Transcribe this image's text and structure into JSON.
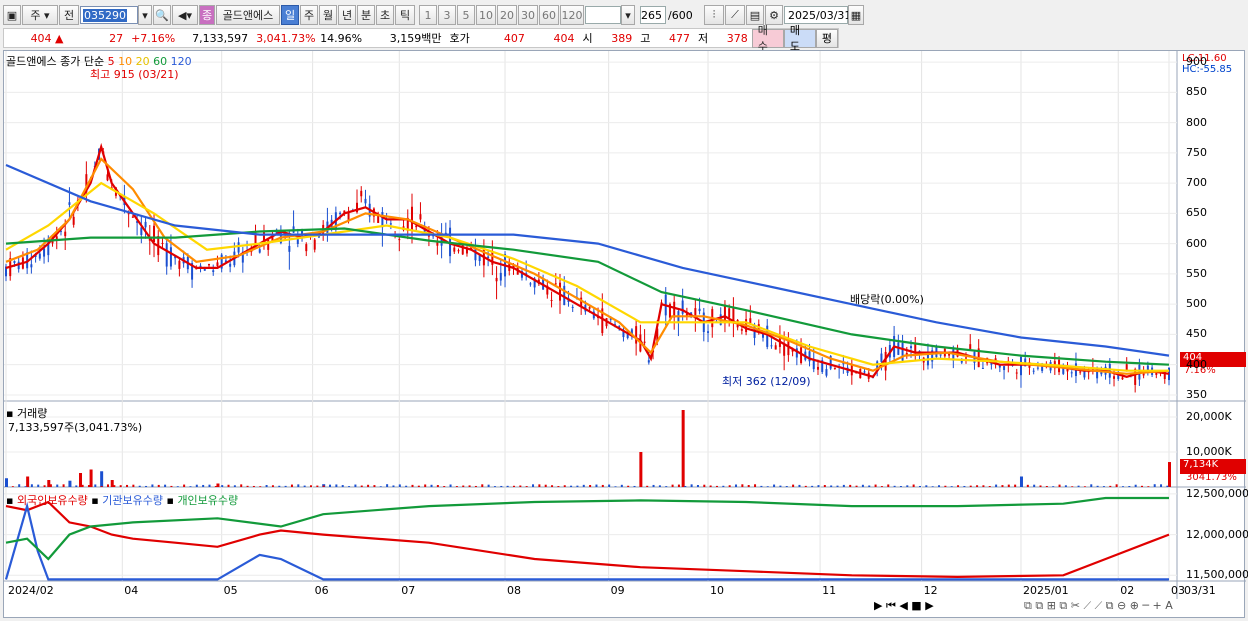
{
  "toolbar": {
    "market": "주",
    "prev": "전",
    "code": "035290",
    "stock_name": "골드앤에스",
    "period_buttons": [
      "일",
      "주",
      "월",
      "년",
      "분",
      "초",
      "틱"
    ],
    "selected_period": "일",
    "intervals": [
      "1",
      "3",
      "5",
      "10",
      "20",
      "30",
      "60",
      "120"
    ],
    "count": "265",
    "count_max": "/600",
    "date": "2025/03/31"
  },
  "quote": {
    "price": "404 ▲",
    "change": "27",
    "change_pct": "+7.16%",
    "volume": "7,133,597",
    "volume_ratio": "3,041.73%",
    "turnover": "14.96%",
    "amount": "3,159백만",
    "hoga_label": "호가",
    "ask": "407",
    "bid": "404",
    "open_label": "시",
    "open": "389",
    "high_label": "고",
    "high": "477",
    "low_label": "저",
    "low": "378",
    "buy": "매수",
    "sell": "매도",
    "avg": "평"
  },
  "price_panel": {
    "name": "골드앤에스",
    "legend_prefix": "종가 단순",
    "ma": [
      "5",
      "10",
      "20",
      "60",
      "120"
    ],
    "ma_colors": [
      "#e00000",
      "#ff8c00",
      "#ffd700",
      "#129a3a",
      "#2a5bd7"
    ],
    "high_note": "최고 915 (03/21)",
    "low_note": "최저 362 (12/09)",
    "dividend_note": "배당락(0.00%)",
    "lc": "LC:11.60",
    "hc": "HC:-55.85",
    "last_price": "404",
    "last_pct": "7.16%"
  },
  "volume_panel": {
    "title": "거래량",
    "info": "7,133,597주(3,041.73%)",
    "last": "7,134K",
    "last_pct": "3041.73%"
  },
  "holding_panel": {
    "series": [
      "외국인보유수량",
      "기관보유수량",
      "개인보유수량"
    ],
    "colors": [
      "#e00000",
      "#2a5bd7",
      "#129a3a"
    ]
  },
  "x_labels": [
    "2024/02",
    "04",
    "05",
    "06",
    "07",
    "08",
    "09",
    "10",
    "11",
    "12",
    "2025/01",
    "02",
    "03",
    "03/31"
  ],
  "chart_data": [
    {
      "type": "line",
      "title": "골드앤에스",
      "y_ticks": [
        350,
        400,
        450,
        500,
        550,
        600,
        650,
        700,
        750,
        800,
        850,
        900
      ],
      "ylim": [
        340,
        915
      ],
      "series": [
        {
          "name": "5",
          "points": [
            [
              0,
              560
            ],
            [
              10,
              570
            ],
            [
              20,
              600
            ],
            [
              30,
              640
            ],
            [
              40,
              700
            ],
            [
              45,
              760
            ],
            [
              50,
              700
            ],
            [
              60,
              650
            ],
            [
              70,
              600
            ],
            [
              80,
              580
            ],
            [
              90,
              560
            ],
            [
              100,
              560
            ],
            [
              110,
              580
            ],
            [
              120,
              600
            ],
            [
              130,
              620
            ],
            [
              140,
              610
            ],
            [
              150,
              620
            ],
            [
              160,
              650
            ],
            [
              170,
              660
            ],
            [
              180,
              640
            ],
            [
              190,
              640
            ],
            [
              200,
              620
            ],
            [
              210,
              600
            ],
            [
              220,
              590
            ],
            [
              230,
              570
            ],
            [
              240,
              560
            ],
            [
              250,
              540
            ],
            [
              260,
              520
            ],
            [
              270,
              500
            ],
            [
              280,
              480
            ],
            [
              290,
              460
            ],
            [
              300,
              440
            ],
            [
              305,
              410
            ],
            [
              310,
              500
            ],
            [
              320,
              490
            ],
            [
              330,
              470
            ],
            [
              340,
              480
            ],
            [
              350,
              460
            ],
            [
              360,
              450
            ],
            [
              370,
              430
            ],
            [
              380,
              410
            ],
            [
              390,
              400
            ],
            [
              400,
              390
            ],
            [
              410,
              380
            ],
            [
              420,
              430
            ],
            [
              430,
              420
            ],
            [
              440,
              420
            ],
            [
              450,
              420
            ],
            [
              460,
              410
            ],
            [
              470,
              400
            ],
            [
              480,
              400
            ],
            [
              490,
              400
            ],
            [
              500,
              395
            ],
            [
              510,
              390
            ],
            [
              520,
              390
            ],
            [
              530,
              380
            ],
            [
              540,
              390
            ],
            [
              550,
              385
            ]
          ]
        },
        {
          "name": "10",
          "points": [
            [
              0,
              570
            ],
            [
              15,
              590
            ],
            [
              30,
              640
            ],
            [
              45,
              740
            ],
            [
              60,
              690
            ],
            [
              75,
              610
            ],
            [
              90,
              570
            ],
            [
              110,
              580
            ],
            [
              130,
              610
            ],
            [
              150,
              620
            ],
            [
              170,
              650
            ],
            [
              190,
              640
            ],
            [
              210,
              610
            ],
            [
              230,
              580
            ],
            [
              250,
              550
            ],
            [
              270,
              510
            ],
            [
              290,
              470
            ],
            [
              305,
              420
            ],
            [
              315,
              480
            ],
            [
              330,
              480
            ],
            [
              350,
              465
            ],
            [
              370,
              440
            ],
            [
              390,
              410
            ],
            [
              410,
              390
            ],
            [
              425,
              415
            ],
            [
              445,
              420
            ],
            [
              470,
              405
            ],
            [
              500,
              395
            ],
            [
              530,
              385
            ],
            [
              550,
              390
            ]
          ]
        },
        {
          "name": "20",
          "points": [
            [
              0,
              590
            ],
            [
              20,
              630
            ],
            [
              45,
              700
            ],
            [
              70,
              650
            ],
            [
              95,
              590
            ],
            [
              120,
              600
            ],
            [
              150,
              615
            ],
            [
              180,
              630
            ],
            [
              210,
              610
            ],
            [
              240,
              575
            ],
            [
              270,
              530
            ],
            [
              300,
              470
            ],
            [
              320,
              470
            ],
            [
              350,
              470
            ],
            [
              380,
              430
            ],
            [
              410,
              400
            ],
            [
              440,
              410
            ],
            [
              470,
              405
            ],
            [
              500,
              398
            ],
            [
              530,
              390
            ],
            [
              550,
              390
            ]
          ]
        },
        {
          "name": "60",
          "points": [
            [
              0,
              600
            ],
            [
              40,
              610
            ],
            [
              80,
              610
            ],
            [
              120,
              620
            ],
            [
              160,
              625
            ],
            [
              200,
              605
            ],
            [
              240,
              590
            ],
            [
              280,
              570
            ],
            [
              310,
              520
            ],
            [
              350,
              490
            ],
            [
              400,
              450
            ],
            [
              440,
              430
            ],
            [
              480,
              415
            ],
            [
              520,
              405
            ],
            [
              550,
              400
            ]
          ]
        },
        {
          "name": "120",
          "points": [
            [
              0,
              730
            ],
            [
              40,
              670
            ],
            [
              80,
              630
            ],
            [
              120,
              615
            ],
            [
              160,
              615
            ],
            [
              200,
              615
            ],
            [
              240,
              615
            ],
            [
              280,
              600
            ],
            [
              320,
              560
            ],
            [
              360,
              530
            ],
            [
              400,
              500
            ],
            [
              440,
              470
            ],
            [
              480,
              445
            ],
            [
              520,
              430
            ],
            [
              550,
              415
            ]
          ]
        }
      ]
    },
    {
      "type": "bar",
      "title": "거래량",
      "y_ticks": [
        10000,
        20000
      ],
      "unit": "K",
      "spikes": [
        [
          0,
          2500
        ],
        [
          10,
          3000
        ],
        [
          20,
          2000
        ],
        [
          30,
          1800
        ],
        [
          35,
          4000
        ],
        [
          40,
          5000
        ],
        [
          45,
          4500
        ],
        [
          50,
          2000
        ],
        [
          100,
          1000
        ],
        [
          150,
          800
        ],
        [
          300,
          10000
        ],
        [
          320,
          22000
        ],
        [
          480,
          3000
        ],
        [
          550,
          7134
        ]
      ]
    },
    {
      "type": "line",
      "title": "보유수량",
      "y_ticks": [
        11500000,
        12000000,
        12500000
      ],
      "series": [
        {
          "name": "외국인보유수량",
          "points": [
            [
              0,
              12350000
            ],
            [
              10,
              12300000
            ],
            [
              20,
              12400000
            ],
            [
              30,
              12150000
            ],
            [
              40,
              12100000
            ],
            [
              50,
              12000000
            ],
            [
              60,
              11950000
            ],
            [
              80,
              11900000
            ],
            [
              100,
              11850000
            ],
            [
              120,
              12000000
            ],
            [
              130,
              12050000
            ],
            [
              150,
              12000000
            ],
            [
              200,
              11900000
            ],
            [
              250,
              11700000
            ],
            [
              300,
              11600000
            ],
            [
              350,
              11550000
            ],
            [
              400,
              11500000
            ],
            [
              450,
              11480000
            ],
            [
              500,
              11500000
            ],
            [
              520,
              11700000
            ],
            [
              540,
              11900000
            ],
            [
              550,
              12000000
            ]
          ]
        },
        {
          "name": "기관보유수량",
          "points": [
            [
              0,
              11450000
            ],
            [
              10,
              12350000
            ],
            [
              15,
              11800000
            ],
            [
              20,
              11450000
            ],
            [
              50,
              11450000
            ],
            [
              70,
              11450000
            ],
            [
              100,
              11450000
            ],
            [
              120,
              11750000
            ],
            [
              130,
              11700000
            ],
            [
              150,
              11450000
            ],
            [
              200,
              11450000
            ],
            [
              300,
              11450000
            ],
            [
              400,
              11450000
            ],
            [
              550,
              11450000
            ]
          ]
        },
        {
          "name": "개인보유수량",
          "points": [
            [
              0,
              11900000
            ],
            [
              10,
              11950000
            ],
            [
              20,
              11700000
            ],
            [
              30,
              12000000
            ],
            [
              40,
              12100000
            ],
            [
              60,
              12150000
            ],
            [
              100,
              12200000
            ],
            [
              130,
              12100000
            ],
            [
              150,
              12250000
            ],
            [
              200,
              12350000
            ],
            [
              250,
              12400000
            ],
            [
              300,
              12420000
            ],
            [
              350,
              12400000
            ],
            [
              400,
              12350000
            ],
            [
              450,
              12350000
            ],
            [
              500,
              12380000
            ],
            [
              520,
              12450000
            ],
            [
              550,
              12450000
            ]
          ]
        }
      ]
    }
  ]
}
